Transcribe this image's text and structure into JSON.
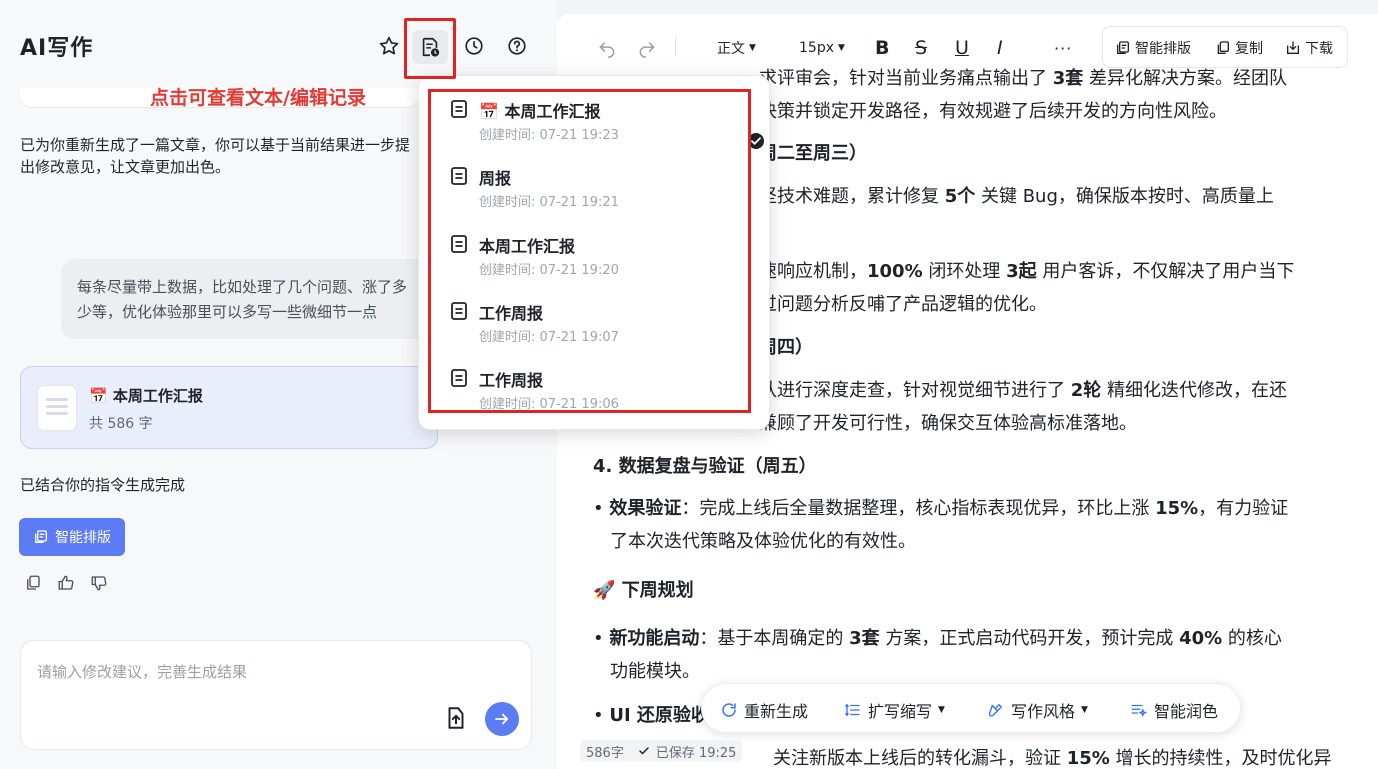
{
  "app": {
    "title": "AI写作"
  },
  "annotation": "点击可查看文本/编辑记录",
  "chat": {
    "ai_msg_1": "已为你重新生成了一篇文章，你可以基于当前结果进一步提出修改意见，让文章更加出色。",
    "user_msg": "每条尽量带上数据，比如处理了几个问题、涨了多少等，优化体验那里可以多写一些微细节一点",
    "doc_card": {
      "title": "📅 本周工作汇报",
      "count": "共 586 字"
    },
    "ai_msg_2": "已结合你的指令生成完成",
    "smart_layout_label": "智能排版"
  },
  "input": {
    "placeholder": "请输入修改建议，完善生成结果"
  },
  "toolbar": {
    "para_style": "正文",
    "font_size": "15px",
    "bold": "B",
    "strike": "S",
    "underline": "U",
    "italic": "I",
    "more": "···",
    "smart_layout": "智能排版",
    "copy": "复制",
    "download": "下载"
  },
  "versions": [
    {
      "title": "📅 本周工作汇报",
      "time": "创建时间: 07-21 19:23",
      "selected": true
    },
    {
      "title": "周报",
      "time": "创建时间: 07-21 19:21",
      "selected": false
    },
    {
      "title": "本周工作汇报",
      "time": "创建时间: 07-21 19:20",
      "selected": false
    },
    {
      "title": "工作周报",
      "time": "创建时间: 07-21 19:07",
      "selected": false
    },
    {
      "title": "工作周报",
      "time": "创建时间: 07-21 19:06",
      "selected": false
    }
  ],
  "content": {
    "l1a": "求评审会，针对当前业务痛点输出了 ",
    "l1b": "3套",
    "l1c": " 差异化解决方案。经团队",
    "l2": "决策并锁定开发路径，有效规避了后续开发的方向性风险。",
    "l3": "周二至周三）",
    "l4a": "坚技术难题，累计修复 ",
    "l4b": "5个",
    "l4c": " 关键 Bug，确保版本按时、高质量上",
    "l6a": "速响应机制，",
    "l6b": "100%",
    "l6c": " 闭环处理 ",
    "l6d": "3起",
    "l6e": " 用户客诉，不仅解决了用户当下",
    "l7": "过问题分析反哺了产品逻辑的优化。",
    "l8": "周四）",
    "l9a": "队进行深度走查，针对视觉细节进行了 ",
    "l9b": "2轮",
    "l9c": " 精细化迭代修改，在还",
    "l10": "兼顾了开发可行性，确保交互体验高标准落地。",
    "h4": "4. 数据复盘与验证（周五）",
    "l11a": "• ",
    "l11b": "效果验证",
    "l11c": "：完成上线后全量数据整理，核心指标表现优异，环比上涨 ",
    "l11d": "15%",
    "l11e": "，有力验证",
    "l12": "了本次迭代策略及体验优化的有效性。",
    "h5": "🚀 下周规划",
    "l13a": "• ",
    "l13b": "新功能启动",
    "l13c": "：基于本周确定的 ",
    "l13d": "3套",
    "l13e": " 方案，正式启动代码开发，预计完成 ",
    "l13f": "40%",
    "l13g": " 的核心",
    "l14": "功能模块。",
    "l15a": "• ",
    "l15b": "UI 还原验收",
    "l16a": "关注新版本上线后的转化漏斗，验证 ",
    "l16b": "15%",
    "l16c": " 增长的持续性，及时优化异"
  },
  "float_bar": {
    "regenerate": "重新生成",
    "expand": "扩写缩写",
    "style": "写作风格",
    "polish": "智能润色"
  },
  "status": {
    "count": "586字",
    "saved": "已保存 19:25"
  }
}
